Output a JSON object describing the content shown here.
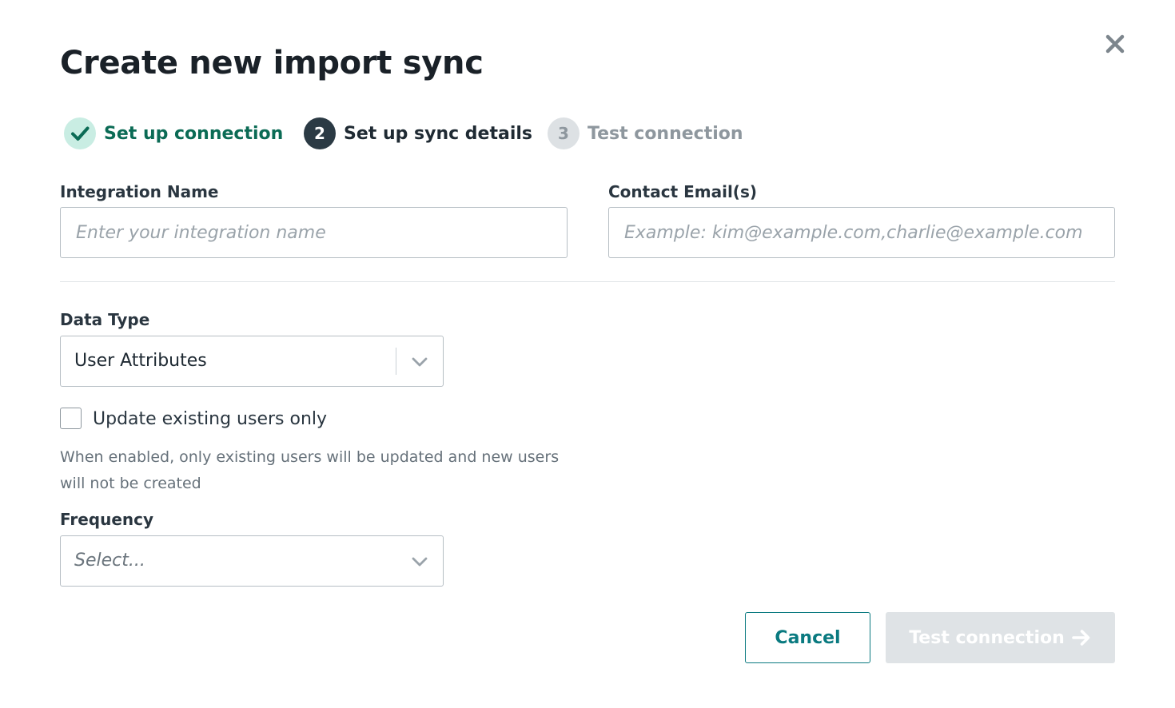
{
  "dialog": {
    "title": "Create new import sync",
    "close_icon": "close-icon"
  },
  "stepper": [
    {
      "number": "",
      "label": "Set up connection",
      "status": "completed",
      "icon": "checkmark-icon"
    },
    {
      "number": "2",
      "label": "Set up sync details",
      "status": "active"
    },
    {
      "number": "3",
      "label": "Test connection",
      "status": "pending"
    }
  ],
  "form": {
    "integration_name": {
      "label": "Integration Name",
      "value": "",
      "placeholder": "Enter your integration name"
    },
    "contact_emails": {
      "label": "Contact Email(s)",
      "value": "",
      "placeholder": "Example: kim@example.com,charlie@example.com"
    },
    "data_type": {
      "label": "Data Type",
      "selected": "User Attributes"
    },
    "update_existing": {
      "label": "Update existing users only",
      "checked": false,
      "help": "When enabled, only existing users will be updated and new users will not be created"
    },
    "frequency": {
      "label": "Frequency",
      "placeholder": "Select..."
    }
  },
  "actions": {
    "cancel_label": "Cancel",
    "test_label": "Test connection",
    "test_icon": "arrow-right-icon",
    "test_disabled": true
  },
  "colors": {
    "accent": "#0a7a80",
    "step_done_text": "#0b6b55",
    "step_done_bg": "#c9ede3",
    "step_active_bg": "#2b3a44",
    "step_pending": "#8e979e",
    "disabled_button_bg": "#dfe3e6"
  }
}
